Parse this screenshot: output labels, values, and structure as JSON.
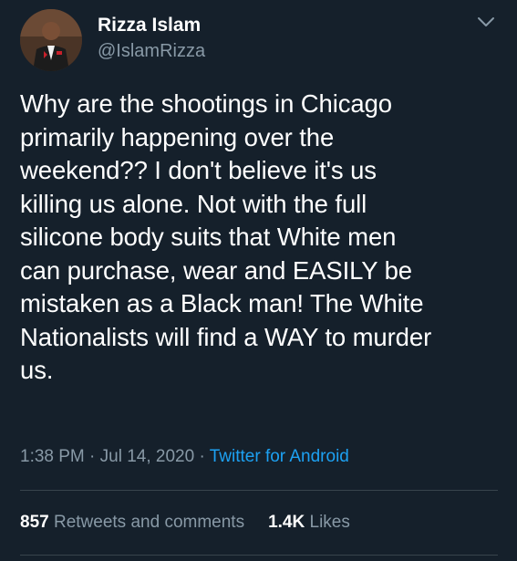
{
  "user": {
    "display_name": "Rizza Islam",
    "handle": "@IslamRizza"
  },
  "tweet": {
    "text": "Why are the shootings in Chicago\nprimarily happening over the\nweekend?? I don't believe it's us\nkilling us alone. Not with the full\nsilicone body suits that White men\ncan purchase, wear and EASILY be\nmistaken as a Black man! The White\nNationalists will find a WAY to murder\nus.",
    "time": "1:38 PM",
    "separator": "·",
    "date": "Jul 14, 2020",
    "source": "Twitter for Android"
  },
  "stats": {
    "retweets_count": "857",
    "retweets_label": "Retweets and comments",
    "likes_count": "1.4K",
    "likes_label": "Likes"
  },
  "icons": {
    "menu": "chevron-down-icon"
  },
  "colors": {
    "background": "#15202b",
    "secondary_text": "#8899a6",
    "link": "#1da1f2",
    "divider": "#38444d"
  }
}
